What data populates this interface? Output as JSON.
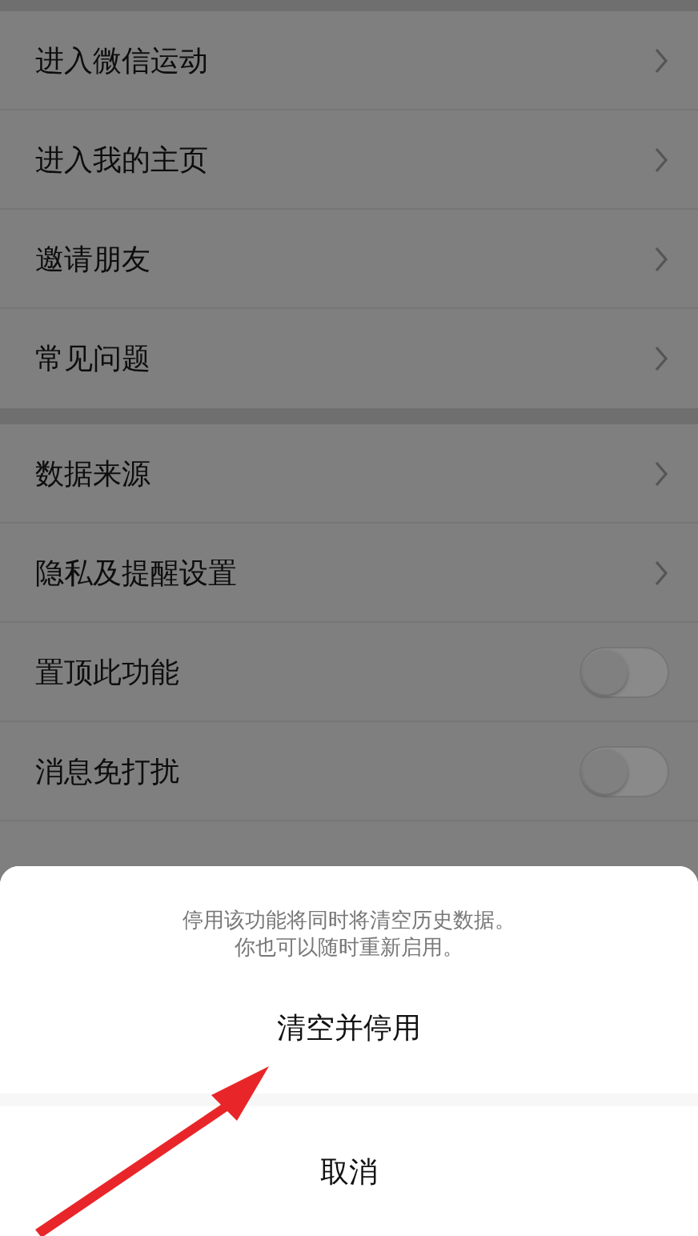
{
  "sections": [
    {
      "items": [
        {
          "kind": "link",
          "label": "进入微信运动"
        },
        {
          "kind": "link",
          "label": "进入我的主页"
        },
        {
          "kind": "link",
          "label": "邀请朋友"
        },
        {
          "kind": "link",
          "label": "常见问题"
        }
      ]
    },
    {
      "items": [
        {
          "kind": "link",
          "label": "数据来源"
        },
        {
          "kind": "link",
          "label": "隐私及提醒设置"
        },
        {
          "kind": "toggle",
          "label": "置顶此功能",
          "on": false
        },
        {
          "kind": "toggle",
          "label": "消息免打扰",
          "on": false
        },
        {
          "kind": "covered"
        }
      ]
    }
  ],
  "action_sheet": {
    "message": [
      "停用该功能将同时将清空历史数据。",
      "你也可以随时重新启用。"
    ],
    "confirm": "清空并停用",
    "cancel": "取消"
  }
}
